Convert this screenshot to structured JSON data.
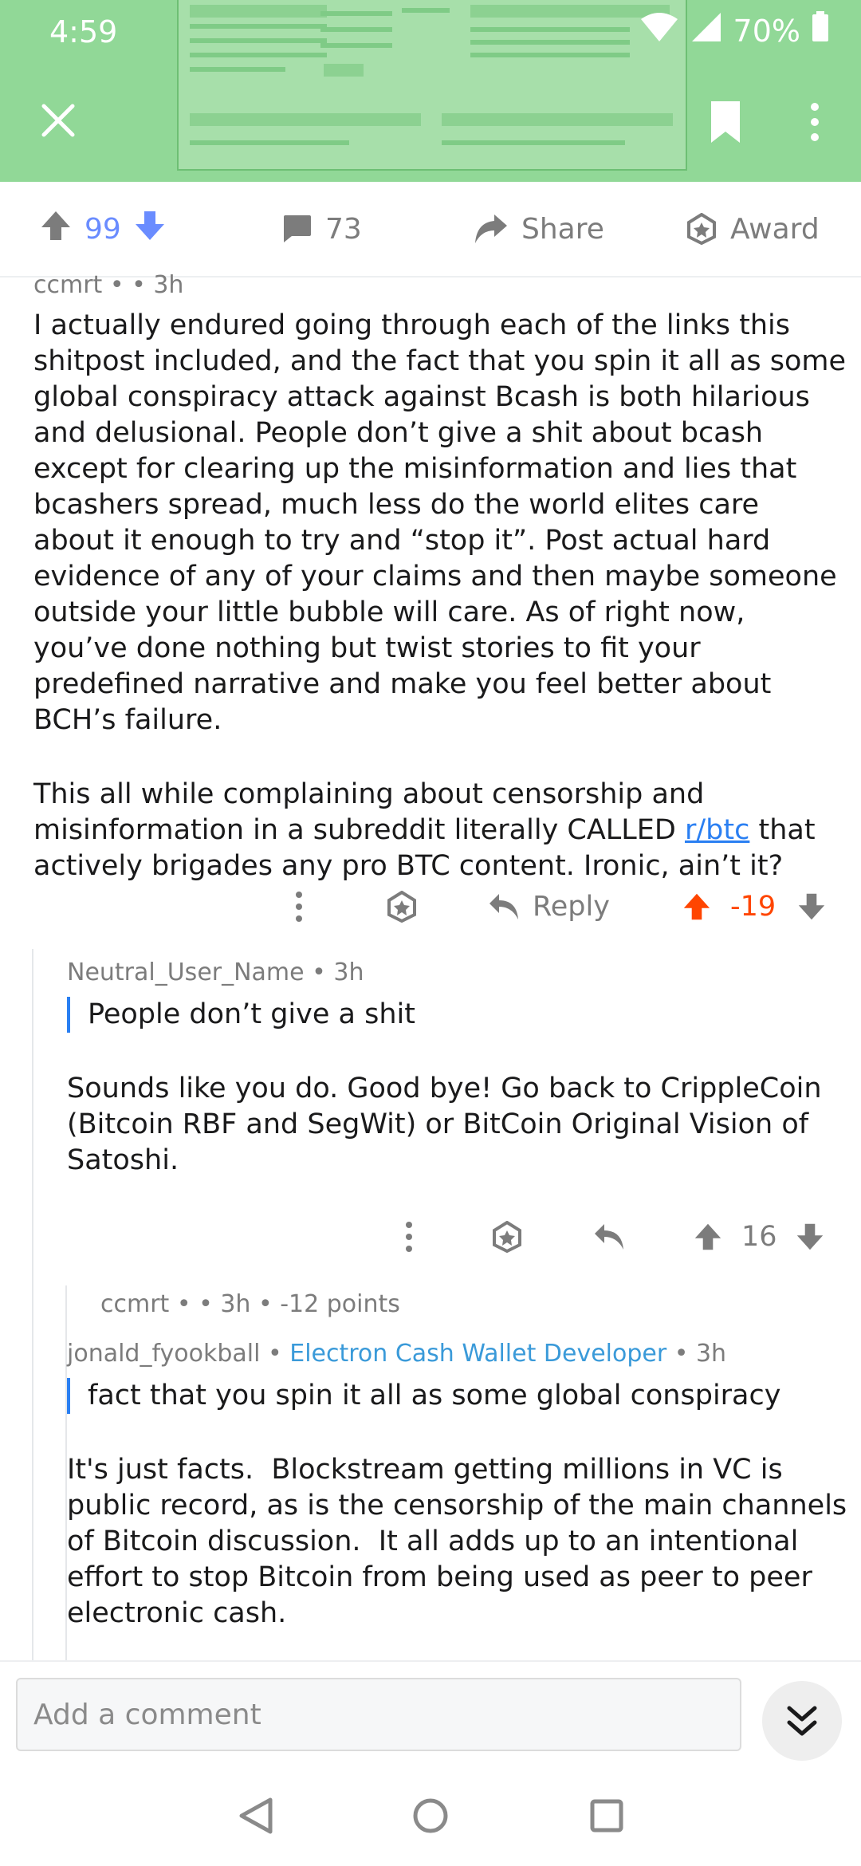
{
  "status_bar": {
    "time": "4:59",
    "battery": "70%"
  },
  "post_actions": {
    "upvotes": "99",
    "comments": "73",
    "share_label": "Share",
    "award_label": "Award"
  },
  "comments": [
    {
      "author": "ccmrt",
      "separator": "•",
      "time": "• 3h",
      "paragraphs": [
        "I actually endured going through each of the links this shitpost included, and the fact that you spin it all as some global conspiracy attack against Bcash is both hilarious and delusional. People don’t give a shit about bcash except for clearing up the misinformation and lies that bcashers spread, much less do the world elites care about it enough to try and “stop it”. Post actual hard evidence of any of your claims and then maybe someone outside your little bubble will care. As of right now, you’ve done nothing but twist stories to fit your predefined narrative and make you feel better about BCH’s failure."
      ],
      "p2_before": "This all while complaining about censorship and misinformation in a subreddit literally CALLED ",
      "p2_link": "r/btc",
      "p2_after": " that actively brigades any pro BTC content. Ironic, ain’t it?",
      "reply_label": "Reply",
      "score": "-19"
    },
    {
      "author": "Neutral_User_Name",
      "time": "• 3h",
      "quote": "People don’t give a shit",
      "body": "Sounds like you do. Good bye! Go back to CrippleCoin (Bitcoin RBF and SegWit) or BitCoin Original Vision of Satoshi.",
      "score": "16"
    },
    {
      "collapsed_author": "ccmrt",
      "collapsed_sep": "•",
      "collapsed_time": "• 3h",
      "collapsed_points": "• -12 points"
    },
    {
      "author": "jonald_fyookball",
      "bullet": "•",
      "flair": "Electron Cash Wallet Developer",
      "time": "• 3h",
      "quote": "fact that you spin it all as some global conspiracy",
      "body": "It's just facts.  Blockstream getting millions in VC is public record, as is the censorship of the main channels of Bitcoin discussion.  It all adds up to an intentional effort to stop Bitcoin from being used as peer to peer electronic cash."
    }
  ],
  "comment_bar": {
    "placeholder": "Add a comment"
  },
  "colors": {
    "header_green": "#91d897",
    "upvote_orange": "#ff4500",
    "vote_blue": "#6a8cff",
    "link_blue": "#2a7ff2",
    "flair_blue": "#3a9ad9"
  }
}
